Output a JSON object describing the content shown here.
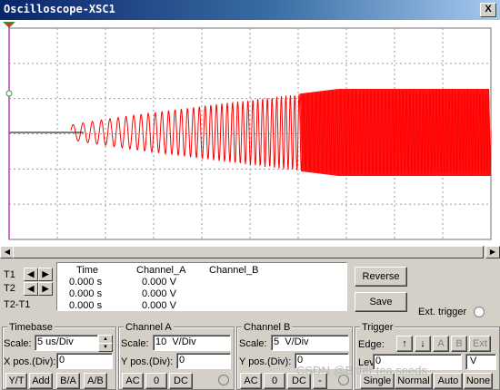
{
  "window": {
    "title": "Oscilloscope-XSC1",
    "close": "X"
  },
  "colors": {
    "trace_a": "#ff0000",
    "grid": "#9a9a9a",
    "marker": "#c040c0"
  },
  "readout": {
    "headers": [
      "Time",
      "Channel_A",
      "Channel_B"
    ],
    "rows": [
      {
        "label": "T1",
        "time": "0.000 s",
        "cha": "0.000 V",
        "chb": ""
      },
      {
        "label": "T2",
        "time": "0.000 s",
        "cha": "0.000 V",
        "chb": ""
      },
      {
        "label": "T2-T1",
        "time": "0.000 s",
        "cha": "0.000 V",
        "chb": ""
      }
    ],
    "reverse_label": "Reverse",
    "save_label": "Save",
    "ext_trigger_label": "Ext. trigger"
  },
  "timebase": {
    "title": "Timebase",
    "scale_label": "Scale:",
    "scale_value": "5 us/Div",
    "xpos_label": "X pos.(Div):",
    "xpos_value": "0",
    "buttons": [
      "Y/T",
      "Add",
      "B/A",
      "A/B"
    ]
  },
  "channel_a": {
    "title": "Channel A",
    "scale_label": "Scale:",
    "scale_value": "10  V/Div",
    "ypos_label": "Y pos.(Div):",
    "ypos_value": "0",
    "buttons": [
      "AC",
      "0",
      "DC"
    ]
  },
  "channel_b": {
    "title": "Channel B",
    "scale_label": "Scale:",
    "scale_value": "5  V/Div",
    "ypos_label": "Y pos.(Div):",
    "ypos_value": "0",
    "buttons": [
      "AC",
      "0",
      "DC",
      "-"
    ]
  },
  "trigger": {
    "title": "Trigger",
    "edge_label": "Edge:",
    "edge_buttons": [
      "↑",
      "↓",
      "A",
      "B",
      "Ext"
    ],
    "level_label": "Level:",
    "level_value": "0",
    "level_unit": "V",
    "mode_buttons": [
      "Single",
      "Normal",
      "Auto",
      "None"
    ]
  },
  "watermark": "CSDN @Bitter tea seeds",
  "icons": {
    "cursor_t1": "t1-cursor-icon",
    "cursor_t2": "t2-cursor-icon",
    "left": "arrow-left-icon",
    "right": "arrow-right-icon"
  }
}
